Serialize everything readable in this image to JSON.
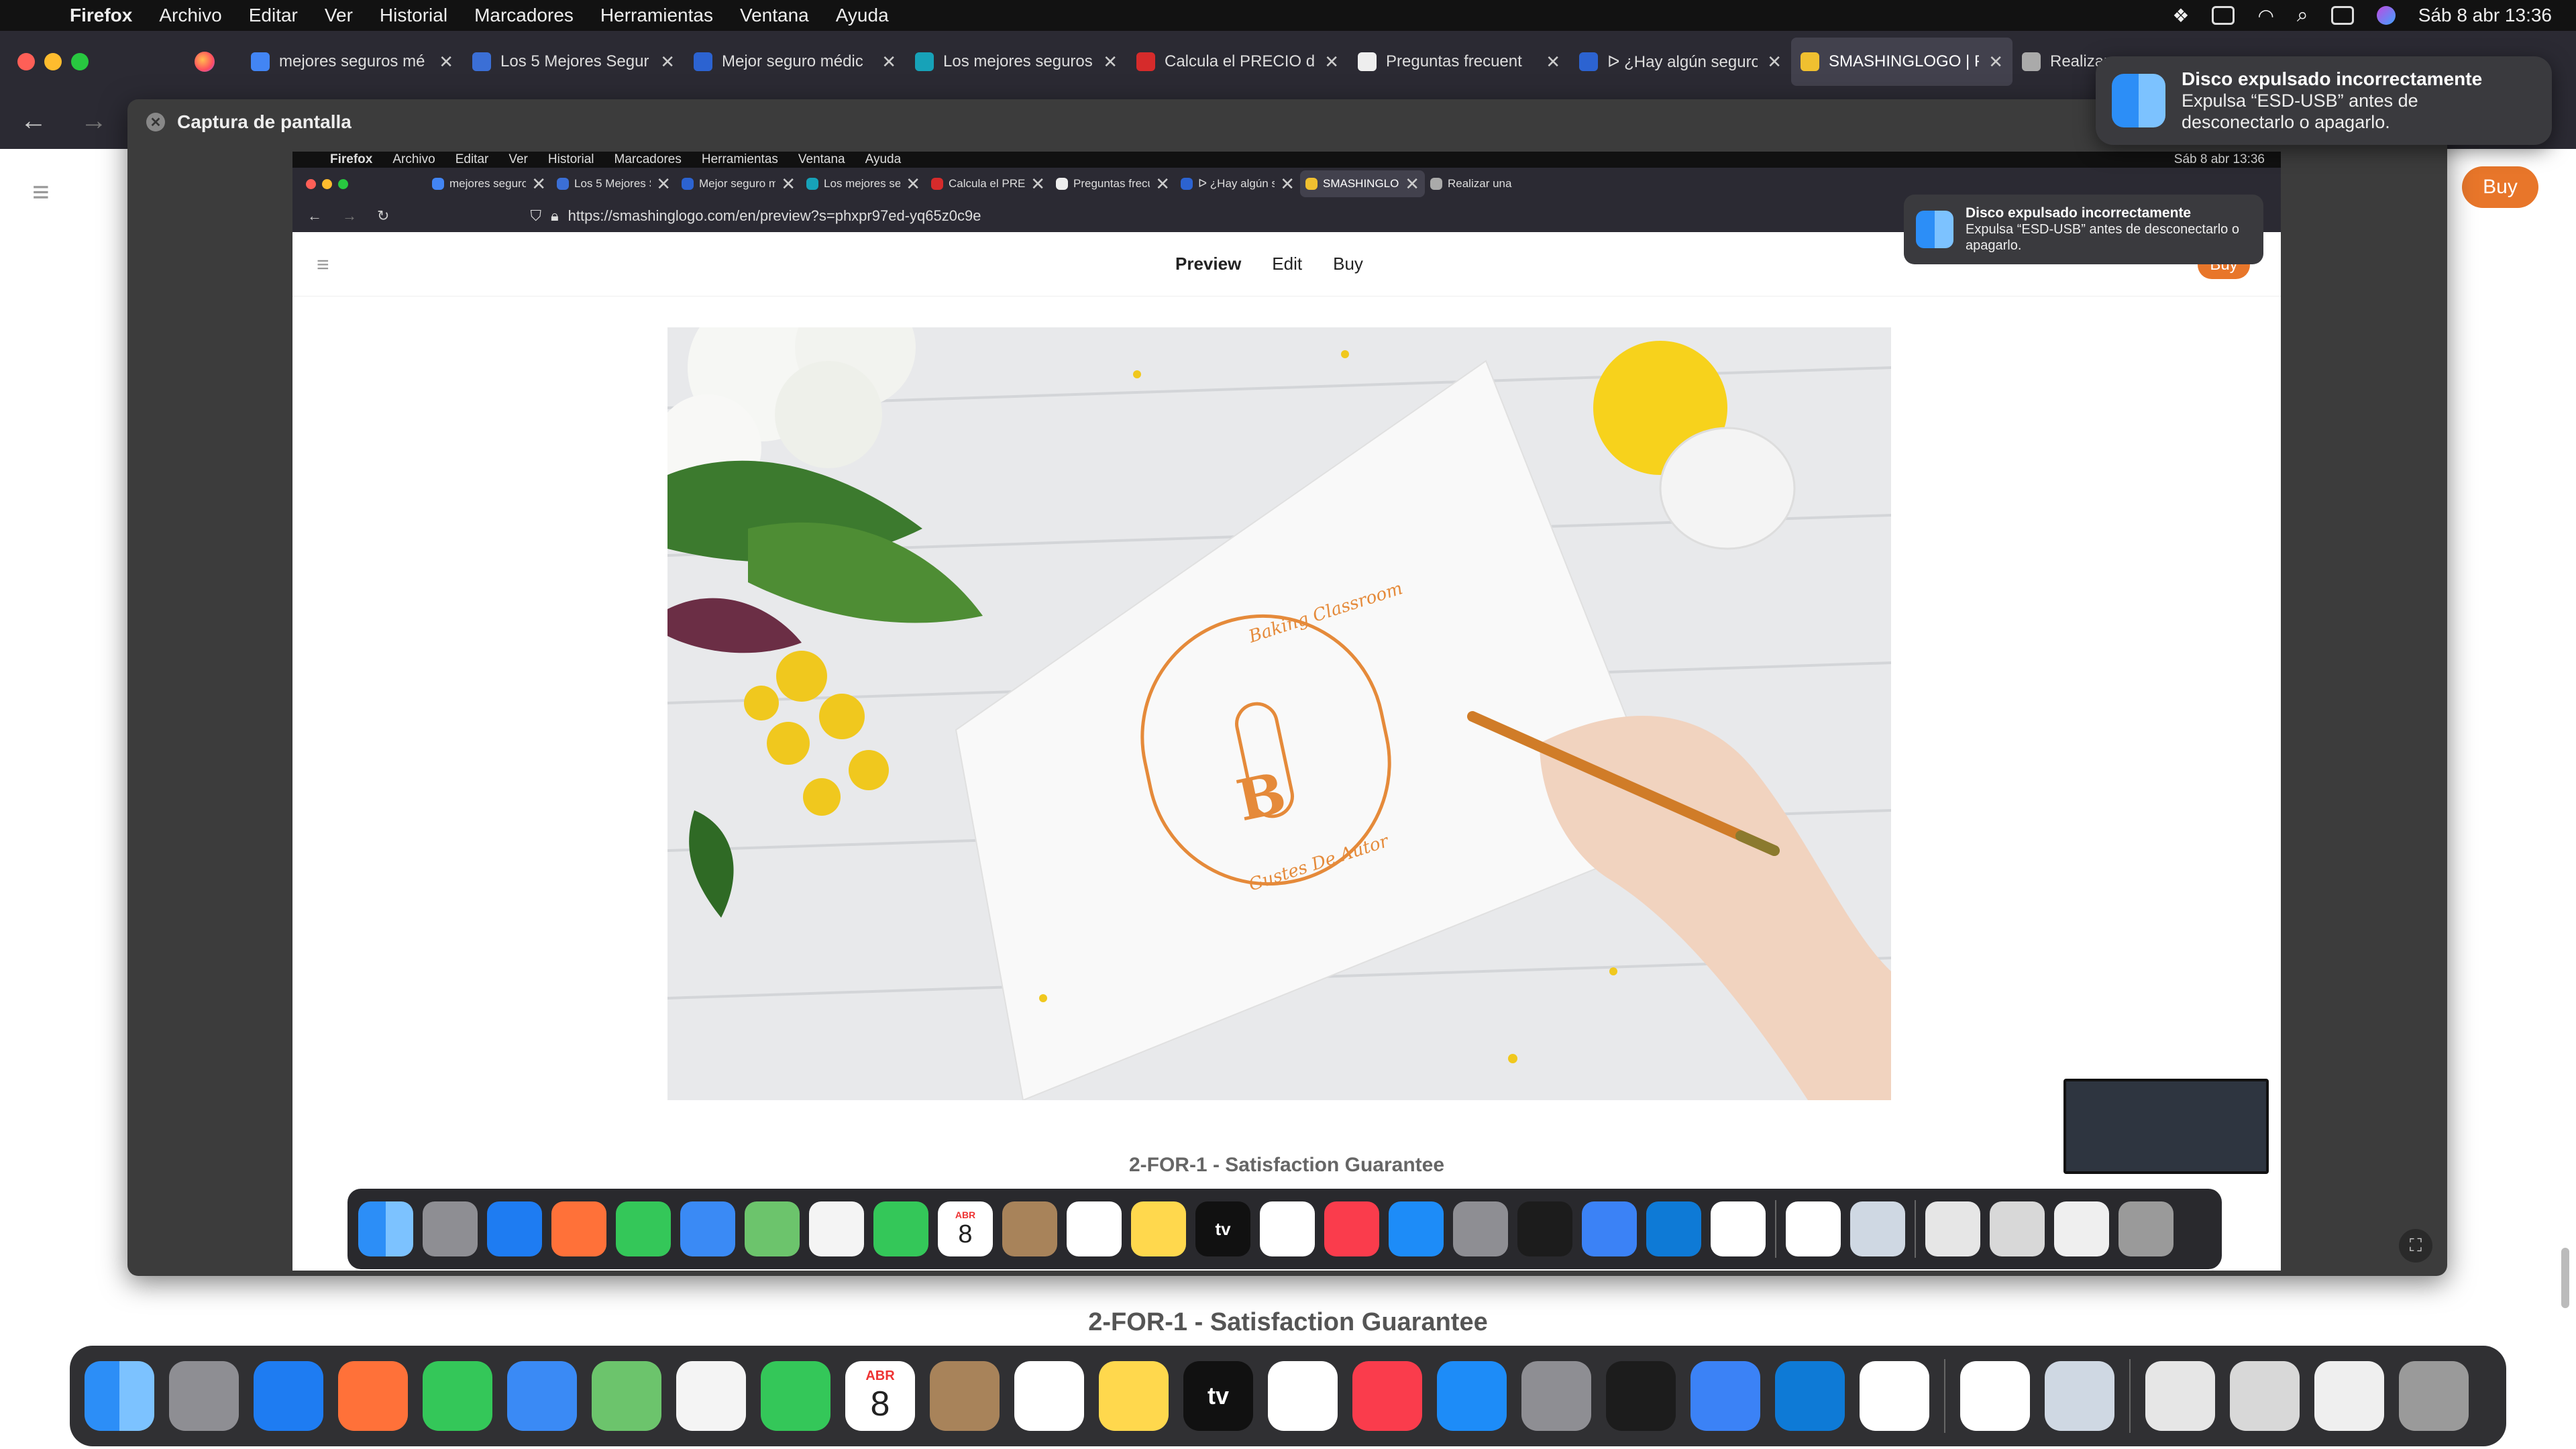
{
  "menubar": {
    "app": "Firefox",
    "items": [
      "Archivo",
      "Editar",
      "Ver",
      "Historial",
      "Marcadores",
      "Herramientas",
      "Ventana",
      "Ayuda"
    ],
    "clock": "Sáb 8 abr 13:36"
  },
  "tabs": [
    {
      "title": "mejores seguros mé",
      "color": "#4285f4"
    },
    {
      "title": "Los 5 Mejores Segur",
      "color": "#3b6fd6"
    },
    {
      "title": "Mejor seguro médic",
      "color": "#2c63d1"
    },
    {
      "title": "Los mejores seguros",
      "color": "#17a2b8"
    },
    {
      "title": "Calcula el PRECIO d",
      "color": "#d62b2b"
    },
    {
      "title": "Preguntas frecuent",
      "color": "#eeeeee"
    },
    {
      "title": "ᐅ ¿Hay algún seguro",
      "color": "#2c63d1"
    },
    {
      "title": "SMASHINGLOGO | P",
      "color": "#f0c030"
    },
    {
      "title": "Realizar una",
      "color": "#aaaaaa"
    }
  ],
  "active_tab_index": 7,
  "site": {
    "buy_label": "Buy",
    "guarantee": "2-FOR-1 - Satisfaction Guarantee"
  },
  "screenshot_panel": {
    "title": "Captura de pantalla",
    "inner": {
      "clock": "Sáb 8 abr 13:36",
      "url": "https://smashinglogo.com/en/preview?s=phxpr97ed-yq65z0c9e",
      "nav": [
        "Preview",
        "Edit",
        "Buy"
      ],
      "buy_label": "Buy",
      "guarantee": "2-FOR-1 - Satisfaction Guarantee",
      "logo_top": "Baking Classroom",
      "logo_letter": "B",
      "logo_bottom": "Gustes De Autor"
    }
  },
  "notification": {
    "title": "Disco expulsado incorrectamente",
    "body": "Expulsa “ESD-USB” antes de desconectarlo o apagarlo."
  },
  "dock": {
    "calendar_month": "ABR",
    "calendar_day": "8",
    "apps": [
      "finder",
      "launchpad",
      "safari",
      "firefox",
      "messages",
      "mail",
      "maps",
      "photos",
      "facetime",
      "calendar",
      "contacts",
      "reminders",
      "notes",
      "tv",
      "freeform",
      "music",
      "app-store",
      "system-settings",
      "terminal",
      "xcode",
      "vscode",
      "instruments",
      "clock",
      "preview",
      "window-1",
      "window-2",
      "window-3",
      "trash"
    ],
    "tv_label": "tv"
  },
  "colors": {
    "accent_orange": "#e8762a",
    "tab_bar": "#2b2a33",
    "menubar": "#121212"
  }
}
